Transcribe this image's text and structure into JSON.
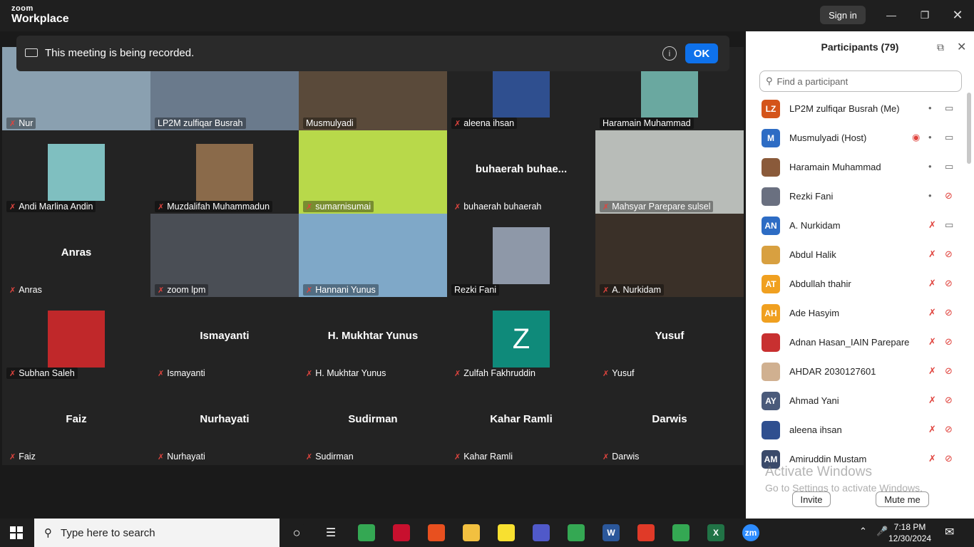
{
  "app": {
    "brand_top": "zoom",
    "brand_bottom": "Workplace",
    "signin_label": "Sign in"
  },
  "banner": {
    "text": "This meeting is being recorded.",
    "info_icon": "i",
    "ok_label": "OK"
  },
  "gallery": {
    "tiles": [
      {
        "label": "Nur",
        "muted": true,
        "kind": "video",
        "color": "#8aa0b0"
      },
      {
        "label": "LP2M zulfiqar Busrah",
        "muted": false,
        "kind": "video",
        "color": "#6a7a8c"
      },
      {
        "label": "Musmulyadi",
        "muted": false,
        "kind": "video",
        "color": "#5a4a3a",
        "active": true
      },
      {
        "label": "aleena ihsan",
        "muted": true,
        "kind": "photo",
        "color": "#2f4f8f"
      },
      {
        "label": "Haramain Muhammad",
        "muted": false,
        "kind": "photo",
        "color": "#6aa8a0"
      },
      {
        "label": "Andi Marlina Andin",
        "muted": true,
        "kind": "photo",
        "color": "#7fbfc0"
      },
      {
        "label": "Muzdalifah Muhammadun",
        "muted": true,
        "kind": "photo",
        "color": "#8a6a4a"
      },
      {
        "label": "sumarnisumai",
        "muted": true,
        "kind": "video",
        "color": "#b8d94a"
      },
      {
        "label": "buhaerah buhaerah",
        "muted": true,
        "kind": "name",
        "center": "buhaerah  buhae..."
      },
      {
        "label": "Mahsyar  Parepare sulsel",
        "muted": true,
        "kind": "video",
        "color": "#b8bcb8"
      },
      {
        "label": "Anras",
        "muted": true,
        "kind": "name",
        "center": "Anras"
      },
      {
        "label": "zoom lpm",
        "muted": true,
        "kind": "video",
        "color": "#4a4e55"
      },
      {
        "label": "Hannani Yunus",
        "muted": true,
        "kind": "video",
        "color": "#7fa8c8"
      },
      {
        "label": "Rezki Fani",
        "muted": false,
        "kind": "photo",
        "color": "#8e98a8"
      },
      {
        "label": "A. Nurkidam",
        "muted": true,
        "kind": "video",
        "color": "#3a3028"
      },
      {
        "label": "Subhan Saleh",
        "muted": true,
        "kind": "photo",
        "color": "#c0282a"
      },
      {
        "label": "Ismayanti",
        "muted": true,
        "kind": "name",
        "center": "Ismayanti"
      },
      {
        "label": "H. Mukhtar Yunus",
        "muted": true,
        "kind": "name",
        "center": "H. Mukhtar Yunus"
      },
      {
        "label": "Zulfah Fakhruddin",
        "muted": true,
        "kind": "letter",
        "center": "Z",
        "color": "#0f8a7a"
      },
      {
        "label": "Yusuf",
        "muted": true,
        "kind": "name",
        "center": "Yusuf"
      },
      {
        "label": "Faiz",
        "muted": true,
        "kind": "name",
        "center": "Faiz"
      },
      {
        "label": "Nurhayati",
        "muted": true,
        "kind": "name",
        "center": "Nurhayati"
      },
      {
        "label": "Sudirman",
        "muted": true,
        "kind": "name",
        "center": "Sudirman"
      },
      {
        "label": "Kahar Ramli",
        "muted": true,
        "kind": "name",
        "center": "Kahar Ramli"
      },
      {
        "label": "Darwis",
        "muted": true,
        "kind": "name",
        "center": "Darwis"
      }
    ]
  },
  "participants": {
    "title": "Participants (79)",
    "search_placeholder": "Find a participant",
    "items": [
      {
        "initials": "LZ",
        "name": "LP2M zulfiqar Busrah (Me)",
        "color": "#d4541a",
        "mic": "on",
        "cam": "on",
        "rec": false
      },
      {
        "initials": "M",
        "name": "Musmulyadi (Host)",
        "color": "#2d6cc4",
        "mic": "on",
        "cam": "on",
        "rec": true
      },
      {
        "initials": "",
        "name": "Haramain Muhammad",
        "color": "#8a5a3a",
        "mic": "on",
        "cam": "on",
        "rec": false
      },
      {
        "initials": "",
        "name": "Rezki Fani",
        "color": "#6a7080",
        "mic": "on",
        "cam": "off",
        "rec": false
      },
      {
        "initials": "AN",
        "name": "A. Nurkidam",
        "color": "#2d6cc4",
        "mic": "off",
        "cam": "on",
        "rec": false
      },
      {
        "initials": "",
        "name": "Abdul Halik",
        "color": "#d8a040",
        "mic": "off",
        "cam": "off",
        "rec": false
      },
      {
        "initials": "AT",
        "name": "Abdullah thahir",
        "color": "#f0a020",
        "mic": "off",
        "cam": "off",
        "rec": false
      },
      {
        "initials": "AH",
        "name": "Ade Hasyim",
        "color": "#f0a020",
        "mic": "off",
        "cam": "off",
        "rec": false
      },
      {
        "initials": "",
        "name": "Adnan Hasan_IAIN Parepare",
        "color": "#c83030",
        "mic": "off",
        "cam": "off",
        "rec": false
      },
      {
        "initials": "",
        "name": "AHDAR 2030127601",
        "color": "#d0b090",
        "mic": "off",
        "cam": "off",
        "rec": false
      },
      {
        "initials": "AY",
        "name": "Ahmad Yani",
        "color": "#4a5a7a",
        "mic": "off",
        "cam": "off",
        "rec": false
      },
      {
        "initials": "",
        "name": "aleena ihsan",
        "color": "#2f4f8f",
        "mic": "off",
        "cam": "off",
        "rec": false
      },
      {
        "initials": "AM",
        "name": "Amiruddin Mustam",
        "color": "#3a4a6a",
        "mic": "off",
        "cam": "off",
        "rec": false
      }
    ],
    "invite_label": "Invite",
    "muteme_label": "Mute me",
    "watermark_title": "Activate Windows",
    "watermark_sub": "Go to Settings to activate Windows."
  },
  "taskbar": {
    "search_placeholder": "Type here to search",
    "time": "7:18 PM",
    "date": "12/30/2024",
    "apps": [
      {
        "name": "cortana-icon",
        "color": "#1e1e1e"
      },
      {
        "name": "task-view-icon",
        "color": "#1e1e1e"
      },
      {
        "name": "chrome-icon",
        "color": "#34a853"
      },
      {
        "name": "mendeley-icon",
        "color": "#c8102e"
      },
      {
        "name": "office-icon",
        "color": "#e8501f"
      },
      {
        "name": "file-explorer-icon",
        "color": "#f2c040"
      },
      {
        "name": "sticky-notes-icon",
        "color": "#f8e030"
      },
      {
        "name": "teams-icon",
        "color": "#5059c9"
      },
      {
        "name": "chrome-profile-icon",
        "color": "#34a853"
      },
      {
        "name": "word-icon",
        "color": "#2b579a"
      },
      {
        "name": "acrobat-icon",
        "color": "#e03a28"
      },
      {
        "name": "chrome-profile2-icon",
        "color": "#34a853"
      },
      {
        "name": "excel-icon",
        "color": "#217346"
      },
      {
        "name": "zoom-app-icon",
        "color": "#2d8cff"
      }
    ]
  }
}
